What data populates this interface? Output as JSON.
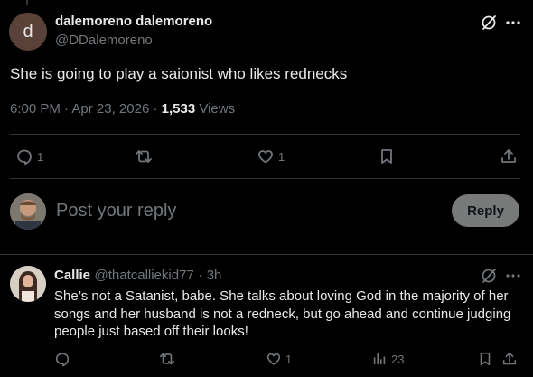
{
  "main_tweet": {
    "avatar_letter": "d",
    "display_name": "dalemoreno dalemoreno",
    "handle": "@DDalemoreno",
    "text": "She is going to play a saionist who likes rednecks",
    "time": "6:00 PM",
    "date": "Apr 23, 2026",
    "views_count": "1,533",
    "views_label": "Views",
    "actions": {
      "replies": "1",
      "reposts": "",
      "likes": "1"
    }
  },
  "compose": {
    "placeholder": "Post your reply",
    "reply_button": "Reply"
  },
  "reply_tweet": {
    "display_name": "Callie",
    "handle": "@thatcalliekid77",
    "time": "3h",
    "text": "She’s not a Satanist, babe. She talks about loving God in the majority of her songs and her husband is not a redneck, but go ahead and continue judging people just based off their looks!",
    "actions": {
      "replies": "",
      "reposts": "",
      "likes": "1",
      "views": "23"
    }
  },
  "colors": {
    "background": "#000000",
    "text": "#e7e9ea",
    "secondary_text": "#71767b",
    "divider": "#2f3336",
    "reply_button_bg": "#787a7a"
  },
  "icons": [
    "grok-icon",
    "more-icon",
    "reply-icon",
    "repost-icon",
    "like-icon",
    "bookmark-icon",
    "share-icon",
    "views-icon"
  ]
}
